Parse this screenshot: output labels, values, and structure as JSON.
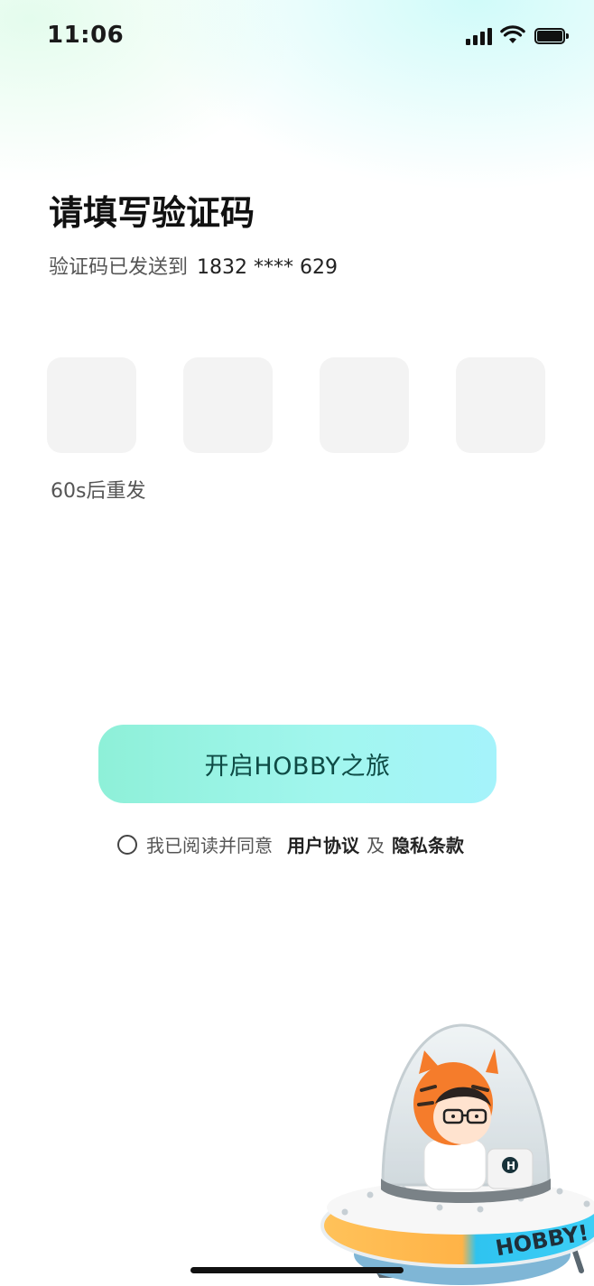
{
  "status_bar": {
    "time": "11:06"
  },
  "page": {
    "title": "请填写验证码",
    "subtitle_prefix": "验证码已发送到",
    "phone_masked": "1832 **** 629",
    "code_boxes": [
      "",
      "",
      "",
      ""
    ],
    "resend_label": "60s后重发"
  },
  "primary_button": {
    "label": "开启HOBBY之旅"
  },
  "agreement": {
    "prefix": "我已阅读并同意",
    "user_agreement": "用户协议",
    "conjunction": "及",
    "privacy_policy": "隐私条款"
  },
  "mascot": {
    "badge_letter": "H",
    "ufo_text": "HOBBY!"
  },
  "colors": {
    "button_gradient_start": "#8ef0d8",
    "button_gradient_end": "#a5f3fb",
    "button_text": "#0e4b45",
    "code_box_bg": "#f3f3f3"
  }
}
